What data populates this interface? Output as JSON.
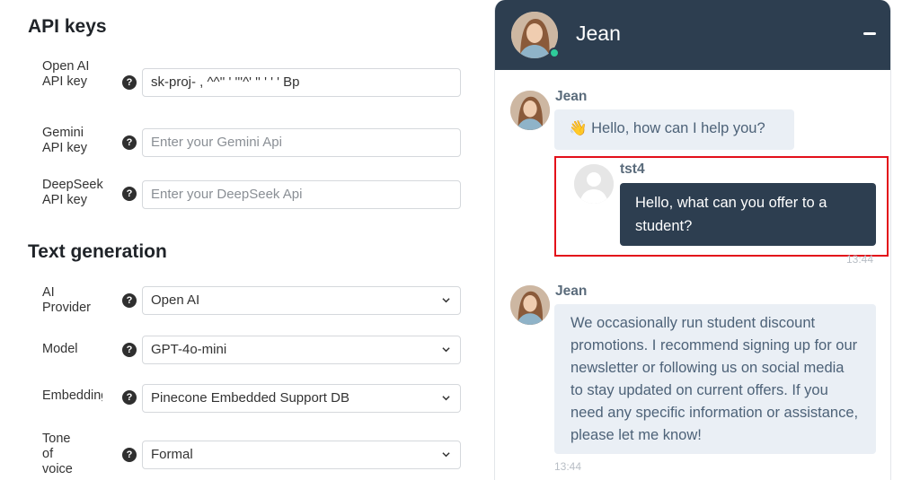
{
  "settings": {
    "api_keys_title": "API keys",
    "openai": {
      "label": "Open AI API key",
      "value": "sk-proj-  ,       ^^''  '   '''^'      ''    '   ' '  Bp"
    },
    "gemini": {
      "label": "Gemini API key",
      "placeholder": "Enter your Gemini Api"
    },
    "deepseek": {
      "label": "DeepSeek API key",
      "placeholder": "Enter your DeepSeek Api"
    },
    "text_gen_title": "Text generation",
    "provider": {
      "label": "AI Provider",
      "value": "Open AI"
    },
    "model": {
      "label": "Model",
      "value": "GPT-4o-mini"
    },
    "embedding": {
      "label": "Embedding",
      "value": "Pinecone Embedded Support DB"
    },
    "tone": {
      "label": "Tone of voice",
      "value": "Formal"
    },
    "help_glyph": "?"
  },
  "chat": {
    "agent_name": "Jean",
    "status_color": "#2ecc9a",
    "header_color": "#2d3e50",
    "messages": [
      {
        "sender": "Jean",
        "text": "👋 Hello, how can I help you?"
      },
      {
        "sender": "tst4",
        "text": "Hello, what can you offer to a student?",
        "time": "13:44"
      },
      {
        "sender": "Jean",
        "text": "We occasionally run student discount promotions. I recommend signing up for our newsletter or following us on social media to stay updated on current offers. If you need any specific information or assistance, please let me know!",
        "time": "13:44"
      }
    ],
    "highlight_color": "#e3101a"
  }
}
